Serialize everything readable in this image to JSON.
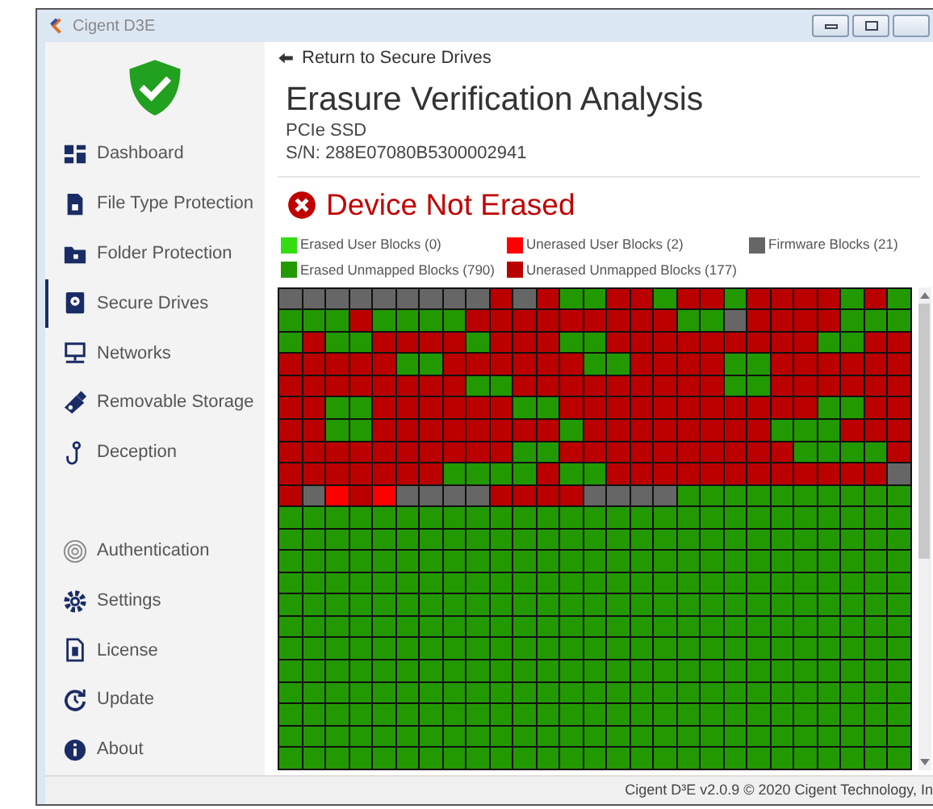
{
  "window": {
    "title": "Cigent D3E"
  },
  "sidebar": {
    "main_items": [
      {
        "label": "Dashboard",
        "selected": false
      },
      {
        "label": "File Type Protection",
        "selected": false
      },
      {
        "label": "Folder Protection",
        "selected": false
      },
      {
        "label": "Secure Drives",
        "selected": true
      },
      {
        "label": "Networks",
        "selected": false
      },
      {
        "label": "Removable Storage",
        "selected": false
      },
      {
        "label": "Deception",
        "selected": false
      }
    ],
    "bottom_items": [
      {
        "label": "Authentication",
        "selected": false
      },
      {
        "label": "Settings",
        "selected": false
      },
      {
        "label": "License",
        "selected": false
      },
      {
        "label": "Update",
        "selected": false
      },
      {
        "label": "About",
        "selected": false
      }
    ]
  },
  "back_link": "Return to Secure Drives",
  "title": "Erasure Verification Analysis",
  "device_type": "PCIe SSD",
  "serial": "S/N: 288E07080B5300002941",
  "status": "Device Not Erased",
  "legend": [
    {
      "kind": "user_erased",
      "label": "Erased User Blocks (0)",
      "color": "#33dd11"
    },
    {
      "kind": "user_unerased",
      "label": "Unerased User Blocks (2)",
      "color": "#ff0000"
    },
    {
      "kind": "firmware",
      "label": "Firmware Blocks (21)",
      "color": "#666666"
    },
    {
      "kind": "erased",
      "label": "Erased Unmapped Blocks (790)",
      "color": "#229900"
    },
    {
      "kind": "unerased",
      "label": "Unerased Unmapped Blocks (177)",
      "color": "#bb0000"
    }
  ],
  "block_map": {
    "rows": [
      {
        "cells": [
          {
            "kind": "firmware"
          },
          {
            "kind": "firmware"
          },
          {
            "kind": "firmware"
          },
          {
            "kind": "firmware"
          },
          {
            "kind": "firmware"
          },
          {
            "kind": "firmware"
          },
          {
            "kind": "firmware"
          },
          {
            "kind": "firmware"
          },
          {
            "kind": "firmware"
          },
          {
            "kind": "unerased"
          },
          {
            "kind": "firmware"
          },
          {
            "kind": "unerased"
          },
          {
            "kind": "erased"
          },
          {
            "kind": "erased"
          },
          {
            "kind": "unerased"
          },
          {
            "kind": "unerased"
          },
          {
            "kind": "erased"
          },
          {
            "kind": "unerased"
          },
          {
            "kind": "unerased"
          },
          {
            "kind": "erased"
          },
          {
            "kind": "unerased"
          },
          {
            "kind": "unerased"
          },
          {
            "kind": "unerased"
          },
          {
            "kind": "unerased"
          },
          {
            "kind": "erased"
          },
          {
            "kind": "unerased"
          },
          {
            "kind": "erased"
          }
        ]
      },
      {
        "cells": [
          {
            "kind": "erased"
          },
          {
            "kind": "erased"
          },
          {
            "kind": "erased"
          },
          {
            "kind": "unerased"
          },
          {
            "kind": "erased"
          },
          {
            "kind": "erased"
          },
          {
            "kind": "erased"
          },
          {
            "kind": "erased"
          },
          {
            "kind": "unerased"
          },
          {
            "kind": "unerased"
          },
          {
            "kind": "unerased"
          },
          {
            "kind": "unerased"
          },
          {
            "kind": "unerased"
          },
          {
            "kind": "unerased"
          },
          {
            "kind": "unerased"
          },
          {
            "kind": "unerased"
          },
          {
            "kind": "unerased"
          },
          {
            "kind": "erased"
          },
          {
            "kind": "erased"
          },
          {
            "kind": "firmware"
          },
          {
            "kind": "unerased"
          },
          {
            "kind": "unerased"
          },
          {
            "kind": "unerased"
          },
          {
            "kind": "unerased"
          },
          {
            "kind": "erased"
          },
          {
            "kind": "erased"
          },
          {
            "kind": "erased"
          }
        ]
      },
      {
        "cells": [
          {
            "kind": "erased"
          },
          {
            "kind": "unerased"
          },
          {
            "kind": "erased"
          },
          {
            "kind": "erased"
          },
          {
            "kind": "unerased"
          },
          {
            "kind": "unerased"
          },
          {
            "kind": "unerased"
          },
          {
            "kind": "unerased"
          },
          {
            "kind": "erased"
          },
          {
            "kind": "unerased"
          },
          {
            "kind": "unerased"
          },
          {
            "kind": "unerased"
          },
          {
            "kind": "erased"
          },
          {
            "kind": "erased"
          },
          {
            "kind": "unerased"
          },
          {
            "kind": "unerased"
          },
          {
            "kind": "unerased"
          },
          {
            "kind": "unerased"
          },
          {
            "kind": "unerased"
          },
          {
            "kind": "unerased"
          },
          {
            "kind": "unerased"
          },
          {
            "kind": "unerased"
          },
          {
            "kind": "unerased"
          },
          {
            "kind": "erased"
          },
          {
            "kind": "erased"
          },
          {
            "kind": "unerased"
          },
          {
            "kind": "unerased"
          }
        ]
      },
      {
        "cells": [
          {
            "kind": "unerased"
          },
          {
            "kind": "unerased"
          },
          {
            "kind": "unerased"
          },
          {
            "kind": "unerased"
          },
          {
            "kind": "unerased"
          },
          {
            "kind": "erased"
          },
          {
            "kind": "erased"
          },
          {
            "kind": "unerased"
          },
          {
            "kind": "unerased"
          },
          {
            "kind": "unerased"
          },
          {
            "kind": "unerased"
          },
          {
            "kind": "unerased"
          },
          {
            "kind": "unerased"
          },
          {
            "kind": "erased"
          },
          {
            "kind": "erased"
          },
          {
            "kind": "unerased"
          },
          {
            "kind": "unerased"
          },
          {
            "kind": "unerased"
          },
          {
            "kind": "unerased"
          },
          {
            "kind": "erased"
          },
          {
            "kind": "erased"
          },
          {
            "kind": "unerased"
          },
          {
            "kind": "unerased"
          },
          {
            "kind": "unerased"
          },
          {
            "kind": "unerased"
          },
          {
            "kind": "unerased"
          },
          {
            "kind": "unerased"
          }
        ]
      },
      {
        "cells": [
          {
            "kind": "unerased"
          },
          {
            "kind": "unerased"
          },
          {
            "kind": "unerased"
          },
          {
            "kind": "unerased"
          },
          {
            "kind": "unerased"
          },
          {
            "kind": "unerased"
          },
          {
            "kind": "unerased"
          },
          {
            "kind": "unerased"
          },
          {
            "kind": "erased"
          },
          {
            "kind": "erased"
          },
          {
            "kind": "unerased"
          },
          {
            "kind": "unerased"
          },
          {
            "kind": "unerased"
          },
          {
            "kind": "unerased"
          },
          {
            "kind": "unerased"
          },
          {
            "kind": "unerased"
          },
          {
            "kind": "unerased"
          },
          {
            "kind": "unerased"
          },
          {
            "kind": "unerased"
          },
          {
            "kind": "erased"
          },
          {
            "kind": "erased"
          },
          {
            "kind": "unerased"
          },
          {
            "kind": "unerased"
          },
          {
            "kind": "unerased"
          },
          {
            "kind": "unerased"
          },
          {
            "kind": "unerased"
          },
          {
            "kind": "unerased"
          }
        ]
      },
      {
        "cells": [
          {
            "kind": "unerased"
          },
          {
            "kind": "unerased"
          },
          {
            "kind": "erased"
          },
          {
            "kind": "erased"
          },
          {
            "kind": "unerased"
          },
          {
            "kind": "unerased"
          },
          {
            "kind": "unerased"
          },
          {
            "kind": "unerased"
          },
          {
            "kind": "unerased"
          },
          {
            "kind": "unerased"
          },
          {
            "kind": "erased"
          },
          {
            "kind": "erased"
          },
          {
            "kind": "unerased"
          },
          {
            "kind": "unerased"
          },
          {
            "kind": "unerased"
          },
          {
            "kind": "unerased"
          },
          {
            "kind": "unerased"
          },
          {
            "kind": "unerased"
          },
          {
            "kind": "unerased"
          },
          {
            "kind": "unerased"
          },
          {
            "kind": "unerased"
          },
          {
            "kind": "unerased"
          },
          {
            "kind": "unerased"
          },
          {
            "kind": "erased"
          },
          {
            "kind": "erased"
          },
          {
            "kind": "unerased"
          },
          {
            "kind": "unerased"
          }
        ]
      },
      {
        "cells": [
          {
            "kind": "unerased"
          },
          {
            "kind": "unerased"
          },
          {
            "kind": "erased"
          },
          {
            "kind": "erased"
          },
          {
            "kind": "unerased"
          },
          {
            "kind": "unerased"
          },
          {
            "kind": "unerased"
          },
          {
            "kind": "unerased"
          },
          {
            "kind": "unerased"
          },
          {
            "kind": "unerased"
          },
          {
            "kind": "unerased"
          },
          {
            "kind": "unerased"
          },
          {
            "kind": "erased"
          },
          {
            "kind": "unerased"
          },
          {
            "kind": "unerased"
          },
          {
            "kind": "unerased"
          },
          {
            "kind": "unerased"
          },
          {
            "kind": "unerased"
          },
          {
            "kind": "unerased"
          },
          {
            "kind": "unerased"
          },
          {
            "kind": "unerased"
          },
          {
            "kind": "erased"
          },
          {
            "kind": "erased"
          },
          {
            "kind": "erased"
          },
          {
            "kind": "unerased"
          },
          {
            "kind": "unerased"
          },
          {
            "kind": "unerased"
          }
        ]
      },
      {
        "cells": [
          {
            "kind": "unerased"
          },
          {
            "kind": "unerased"
          },
          {
            "kind": "unerased"
          },
          {
            "kind": "unerased"
          },
          {
            "kind": "unerased"
          },
          {
            "kind": "unerased"
          },
          {
            "kind": "unerased"
          },
          {
            "kind": "unerased"
          },
          {
            "kind": "unerased"
          },
          {
            "kind": "unerased"
          },
          {
            "kind": "erased"
          },
          {
            "kind": "erased"
          },
          {
            "kind": "unerased"
          },
          {
            "kind": "unerased"
          },
          {
            "kind": "unerased"
          },
          {
            "kind": "unerased"
          },
          {
            "kind": "unerased"
          },
          {
            "kind": "unerased"
          },
          {
            "kind": "unerased"
          },
          {
            "kind": "unerased"
          },
          {
            "kind": "unerased"
          },
          {
            "kind": "unerased"
          },
          {
            "kind": "erased"
          },
          {
            "kind": "erased"
          },
          {
            "kind": "erased"
          },
          {
            "kind": "erased"
          },
          {
            "kind": "unerased"
          }
        ]
      },
      {
        "cells": [
          {
            "kind": "unerased"
          },
          {
            "kind": "unerased"
          },
          {
            "kind": "unerased"
          },
          {
            "kind": "unerased"
          },
          {
            "kind": "unerased"
          },
          {
            "kind": "unerased"
          },
          {
            "kind": "unerased"
          },
          {
            "kind": "erased"
          },
          {
            "kind": "erased"
          },
          {
            "kind": "erased"
          },
          {
            "kind": "erased"
          },
          {
            "kind": "unerased"
          },
          {
            "kind": "erased"
          },
          {
            "kind": "erased"
          },
          {
            "kind": "unerased"
          },
          {
            "kind": "unerased"
          },
          {
            "kind": "unerased"
          },
          {
            "kind": "unerased"
          },
          {
            "kind": "unerased"
          },
          {
            "kind": "unerased"
          },
          {
            "kind": "unerased"
          },
          {
            "kind": "unerased"
          },
          {
            "kind": "unerased"
          },
          {
            "kind": "unerased"
          },
          {
            "kind": "unerased"
          },
          {
            "kind": "unerased"
          },
          {
            "kind": "firmware"
          }
        ]
      },
      {
        "cells": [
          {
            "kind": "unerased"
          },
          {
            "kind": "firmware"
          },
          {
            "kind": "user_unerased"
          },
          {
            "kind": "unerased"
          },
          {
            "kind": "user_unerased"
          },
          {
            "kind": "firmware"
          },
          {
            "kind": "firmware"
          },
          {
            "kind": "firmware"
          },
          {
            "kind": "firmware"
          },
          {
            "kind": "unerased"
          },
          {
            "kind": "unerased"
          },
          {
            "kind": "unerased"
          },
          {
            "kind": "unerased"
          },
          {
            "kind": "firmware"
          },
          {
            "kind": "firmware"
          },
          {
            "kind": "firmware"
          },
          {
            "kind": "firmware"
          },
          {
            "kind": "erased"
          },
          {
            "kind": "erased"
          },
          {
            "kind": "erased"
          },
          {
            "kind": "erased"
          },
          {
            "kind": "erased"
          },
          {
            "kind": "erased"
          },
          {
            "kind": "erased"
          },
          {
            "kind": "erased"
          },
          {
            "kind": "erased"
          },
          {
            "kind": "erased"
          }
        ]
      },
      {
        "cells": [
          {
            "kind": "erased"
          },
          {
            "kind": "erased"
          },
          {
            "kind": "erased"
          },
          {
            "kind": "erased"
          },
          {
            "kind": "erased"
          },
          {
            "kind": "erased"
          },
          {
            "kind": "erased"
          },
          {
            "kind": "erased"
          },
          {
            "kind": "erased"
          },
          {
            "kind": "erased"
          },
          {
            "kind": "erased"
          },
          {
            "kind": "erased"
          },
          {
            "kind": "erased"
          },
          {
            "kind": "erased"
          },
          {
            "kind": "erased"
          },
          {
            "kind": "erased"
          },
          {
            "kind": "erased"
          },
          {
            "kind": "erased"
          },
          {
            "kind": "erased"
          },
          {
            "kind": "erased"
          },
          {
            "kind": "erased"
          },
          {
            "kind": "erased"
          },
          {
            "kind": "erased"
          },
          {
            "kind": "erased"
          },
          {
            "kind": "erased"
          },
          {
            "kind": "erased"
          },
          {
            "kind": "erased"
          }
        ]
      },
      {
        "cells": [
          {
            "kind": "erased"
          },
          {
            "kind": "erased"
          },
          {
            "kind": "erased"
          },
          {
            "kind": "erased"
          },
          {
            "kind": "erased"
          },
          {
            "kind": "erased"
          },
          {
            "kind": "erased"
          },
          {
            "kind": "erased"
          },
          {
            "kind": "erased"
          },
          {
            "kind": "erased"
          },
          {
            "kind": "erased"
          },
          {
            "kind": "erased"
          },
          {
            "kind": "erased"
          },
          {
            "kind": "erased"
          },
          {
            "kind": "erased"
          },
          {
            "kind": "erased"
          },
          {
            "kind": "erased"
          },
          {
            "kind": "erased"
          },
          {
            "kind": "erased"
          },
          {
            "kind": "erased"
          },
          {
            "kind": "erased"
          },
          {
            "kind": "erased"
          },
          {
            "kind": "erased"
          },
          {
            "kind": "erased"
          },
          {
            "kind": "erased"
          },
          {
            "kind": "erased"
          },
          {
            "kind": "erased"
          }
        ]
      },
      {
        "cells": [
          {
            "kind": "erased"
          },
          {
            "kind": "erased"
          },
          {
            "kind": "erased"
          },
          {
            "kind": "erased"
          },
          {
            "kind": "erased"
          },
          {
            "kind": "erased"
          },
          {
            "kind": "erased"
          },
          {
            "kind": "erased"
          },
          {
            "kind": "erased"
          },
          {
            "kind": "erased"
          },
          {
            "kind": "erased"
          },
          {
            "kind": "erased"
          },
          {
            "kind": "erased"
          },
          {
            "kind": "erased"
          },
          {
            "kind": "erased"
          },
          {
            "kind": "erased"
          },
          {
            "kind": "erased"
          },
          {
            "kind": "erased"
          },
          {
            "kind": "erased"
          },
          {
            "kind": "erased"
          },
          {
            "kind": "erased"
          },
          {
            "kind": "erased"
          },
          {
            "kind": "erased"
          },
          {
            "kind": "erased"
          },
          {
            "kind": "erased"
          },
          {
            "kind": "erased"
          },
          {
            "kind": "erased"
          }
        ]
      },
      {
        "cells": [
          {
            "kind": "erased"
          },
          {
            "kind": "erased"
          },
          {
            "kind": "erased"
          },
          {
            "kind": "erased"
          },
          {
            "kind": "erased"
          },
          {
            "kind": "erased"
          },
          {
            "kind": "erased"
          },
          {
            "kind": "erased"
          },
          {
            "kind": "erased"
          },
          {
            "kind": "erased"
          },
          {
            "kind": "erased"
          },
          {
            "kind": "erased"
          },
          {
            "kind": "erased"
          },
          {
            "kind": "erased"
          },
          {
            "kind": "erased"
          },
          {
            "kind": "erased"
          },
          {
            "kind": "erased"
          },
          {
            "kind": "erased"
          },
          {
            "kind": "erased"
          },
          {
            "kind": "erased"
          },
          {
            "kind": "erased"
          },
          {
            "kind": "erased"
          },
          {
            "kind": "erased"
          },
          {
            "kind": "erased"
          },
          {
            "kind": "erased"
          },
          {
            "kind": "erased"
          },
          {
            "kind": "erased"
          }
        ]
      },
      {
        "cells": [
          {
            "kind": "erased"
          },
          {
            "kind": "erased"
          },
          {
            "kind": "erased"
          },
          {
            "kind": "erased"
          },
          {
            "kind": "erased"
          },
          {
            "kind": "erased"
          },
          {
            "kind": "erased"
          },
          {
            "kind": "erased"
          },
          {
            "kind": "erased"
          },
          {
            "kind": "erased"
          },
          {
            "kind": "erased"
          },
          {
            "kind": "erased"
          },
          {
            "kind": "erased"
          },
          {
            "kind": "erased"
          },
          {
            "kind": "erased"
          },
          {
            "kind": "erased"
          },
          {
            "kind": "erased"
          },
          {
            "kind": "erased"
          },
          {
            "kind": "erased"
          },
          {
            "kind": "erased"
          },
          {
            "kind": "erased"
          },
          {
            "kind": "erased"
          },
          {
            "kind": "erased"
          },
          {
            "kind": "erased"
          },
          {
            "kind": "erased"
          },
          {
            "kind": "erased"
          },
          {
            "kind": "erased"
          }
        ]
      },
      {
        "cells": [
          {
            "kind": "erased"
          },
          {
            "kind": "erased"
          },
          {
            "kind": "erased"
          },
          {
            "kind": "erased"
          },
          {
            "kind": "erased"
          },
          {
            "kind": "erased"
          },
          {
            "kind": "erased"
          },
          {
            "kind": "erased"
          },
          {
            "kind": "erased"
          },
          {
            "kind": "erased"
          },
          {
            "kind": "erased"
          },
          {
            "kind": "erased"
          },
          {
            "kind": "erased"
          },
          {
            "kind": "erased"
          },
          {
            "kind": "erased"
          },
          {
            "kind": "erased"
          },
          {
            "kind": "erased"
          },
          {
            "kind": "erased"
          },
          {
            "kind": "erased"
          },
          {
            "kind": "erased"
          },
          {
            "kind": "erased"
          },
          {
            "kind": "erased"
          },
          {
            "kind": "erased"
          },
          {
            "kind": "erased"
          },
          {
            "kind": "erased"
          },
          {
            "kind": "erased"
          },
          {
            "kind": "erased"
          }
        ]
      },
      {
        "cells": [
          {
            "kind": "erased"
          },
          {
            "kind": "erased"
          },
          {
            "kind": "erased"
          },
          {
            "kind": "erased"
          },
          {
            "kind": "erased"
          },
          {
            "kind": "erased"
          },
          {
            "kind": "erased"
          },
          {
            "kind": "erased"
          },
          {
            "kind": "erased"
          },
          {
            "kind": "erased"
          },
          {
            "kind": "erased"
          },
          {
            "kind": "erased"
          },
          {
            "kind": "erased"
          },
          {
            "kind": "erased"
          },
          {
            "kind": "erased"
          },
          {
            "kind": "erased"
          },
          {
            "kind": "erased"
          },
          {
            "kind": "erased"
          },
          {
            "kind": "erased"
          },
          {
            "kind": "erased"
          },
          {
            "kind": "erased"
          },
          {
            "kind": "erased"
          },
          {
            "kind": "erased"
          },
          {
            "kind": "erased"
          },
          {
            "kind": "erased"
          },
          {
            "kind": "erased"
          },
          {
            "kind": "erased"
          }
        ]
      },
      {
        "cells": [
          {
            "kind": "erased"
          },
          {
            "kind": "erased"
          },
          {
            "kind": "erased"
          },
          {
            "kind": "erased"
          },
          {
            "kind": "erased"
          },
          {
            "kind": "erased"
          },
          {
            "kind": "erased"
          },
          {
            "kind": "erased"
          },
          {
            "kind": "erased"
          },
          {
            "kind": "erased"
          },
          {
            "kind": "erased"
          },
          {
            "kind": "erased"
          },
          {
            "kind": "erased"
          },
          {
            "kind": "erased"
          },
          {
            "kind": "erased"
          },
          {
            "kind": "erased"
          },
          {
            "kind": "erased"
          },
          {
            "kind": "erased"
          },
          {
            "kind": "erased"
          },
          {
            "kind": "erased"
          },
          {
            "kind": "erased"
          },
          {
            "kind": "erased"
          },
          {
            "kind": "erased"
          },
          {
            "kind": "erased"
          },
          {
            "kind": "erased"
          },
          {
            "kind": "erased"
          },
          {
            "kind": "erased"
          }
        ]
      },
      {
        "cells": [
          {
            "kind": "erased"
          },
          {
            "kind": "erased"
          },
          {
            "kind": "erased"
          },
          {
            "kind": "erased"
          },
          {
            "kind": "erased"
          },
          {
            "kind": "erased"
          },
          {
            "kind": "erased"
          },
          {
            "kind": "erased"
          },
          {
            "kind": "erased"
          },
          {
            "kind": "erased"
          },
          {
            "kind": "erased"
          },
          {
            "kind": "erased"
          },
          {
            "kind": "erased"
          },
          {
            "kind": "erased"
          },
          {
            "kind": "erased"
          },
          {
            "kind": "erased"
          },
          {
            "kind": "erased"
          },
          {
            "kind": "erased"
          },
          {
            "kind": "erased"
          },
          {
            "kind": "erased"
          },
          {
            "kind": "erased"
          },
          {
            "kind": "erased"
          },
          {
            "kind": "erased"
          },
          {
            "kind": "erased"
          },
          {
            "kind": "erased"
          },
          {
            "kind": "erased"
          },
          {
            "kind": "erased"
          }
        ]
      },
      {
        "cells": [
          {
            "kind": "erased"
          },
          {
            "kind": "erased"
          },
          {
            "kind": "erased"
          },
          {
            "kind": "erased"
          },
          {
            "kind": "erased"
          },
          {
            "kind": "erased"
          },
          {
            "kind": "erased"
          },
          {
            "kind": "erased"
          },
          {
            "kind": "erased"
          },
          {
            "kind": "erased"
          },
          {
            "kind": "erased"
          },
          {
            "kind": "erased"
          },
          {
            "kind": "erased"
          },
          {
            "kind": "erased"
          },
          {
            "kind": "erased"
          },
          {
            "kind": "erased"
          },
          {
            "kind": "erased"
          },
          {
            "kind": "erased"
          },
          {
            "kind": "erased"
          },
          {
            "kind": "erased"
          },
          {
            "kind": "erased"
          },
          {
            "kind": "erased"
          },
          {
            "kind": "erased"
          },
          {
            "kind": "erased"
          },
          {
            "kind": "erased"
          },
          {
            "kind": "erased"
          },
          {
            "kind": "erased"
          }
        ]
      },
      {
        "cells": [
          {
            "kind": "erased"
          },
          {
            "kind": "erased"
          },
          {
            "kind": "erased"
          },
          {
            "kind": "erased"
          },
          {
            "kind": "erased"
          },
          {
            "kind": "erased"
          },
          {
            "kind": "erased"
          },
          {
            "kind": "erased"
          },
          {
            "kind": "erased"
          },
          {
            "kind": "erased"
          },
          {
            "kind": "erased"
          },
          {
            "kind": "erased"
          },
          {
            "kind": "erased"
          },
          {
            "kind": "erased"
          },
          {
            "kind": "erased"
          },
          {
            "kind": "erased"
          },
          {
            "kind": "erased"
          },
          {
            "kind": "erased"
          },
          {
            "kind": "erased"
          },
          {
            "kind": "erased"
          },
          {
            "kind": "erased"
          },
          {
            "kind": "erased"
          },
          {
            "kind": "erased"
          },
          {
            "kind": "erased"
          },
          {
            "kind": "erased"
          },
          {
            "kind": "erased"
          },
          {
            "kind": "erased"
          }
        ]
      },
      {
        "cells": [
          {
            "kind": "erased"
          },
          {
            "kind": "erased"
          },
          {
            "kind": "erased"
          },
          {
            "kind": "erased"
          },
          {
            "kind": "erased"
          },
          {
            "kind": "erased"
          },
          {
            "kind": "erased"
          },
          {
            "kind": "erased"
          },
          {
            "kind": "erased"
          },
          {
            "kind": "erased"
          },
          {
            "kind": "erased"
          },
          {
            "kind": "erased"
          },
          {
            "kind": "erased"
          },
          {
            "kind": "erased"
          },
          {
            "kind": "erased"
          },
          {
            "kind": "erased"
          },
          {
            "kind": "erased"
          },
          {
            "kind": "erased"
          },
          {
            "kind": "erased"
          },
          {
            "kind": "erased"
          },
          {
            "kind": "erased"
          },
          {
            "kind": "erased"
          },
          {
            "kind": "erased"
          },
          {
            "kind": "erased"
          },
          {
            "kind": "erased"
          },
          {
            "kind": "erased"
          },
          {
            "kind": "erased"
          }
        ]
      }
    ]
  },
  "footer": "Cigent D³E v2.0.9 © 2020 Cigent Technology, In"
}
